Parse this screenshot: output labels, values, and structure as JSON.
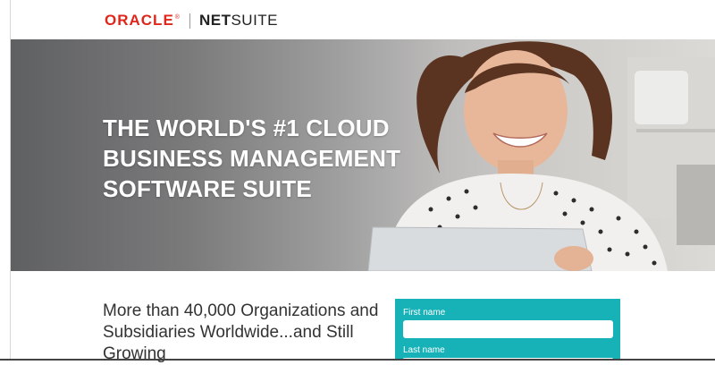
{
  "header": {
    "logo_oracle": "ORACLE",
    "logo_registered": "®",
    "logo_netsuite_bold": "NET",
    "logo_netsuite_regular": "SUITE"
  },
  "hero": {
    "title_lines": [
      "THE WORLD'S #1 CLOUD",
      "BUSINESS MANAGEMENT",
      "SOFTWARE SUITE"
    ]
  },
  "intro": {
    "text": "More than 40,000 Organizations and Subsidiaries Worldwide...and Still Growing"
  },
  "form": {
    "first_name_label": "First name",
    "first_name_value": "",
    "last_name_label": "Last name",
    "last_name_value": ""
  },
  "colors": {
    "oracle_red": "#e0261b",
    "form_teal": "#17b2b8"
  }
}
